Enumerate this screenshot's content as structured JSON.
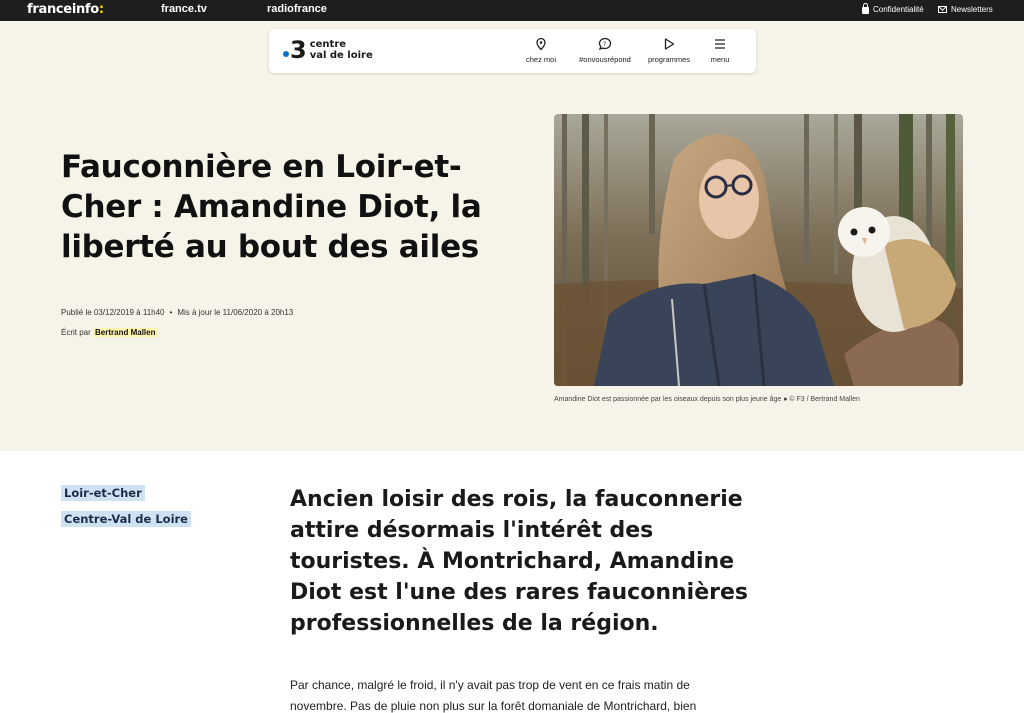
{
  "topbar": {
    "logo_main": "franceinfo",
    "logo_colon": ":",
    "link_francetv": "france.tv",
    "link_radiofrance": "radiofrance",
    "privacy": "Confidentialité",
    "newsletters": "Newsletters"
  },
  "nav": {
    "logo_number": "3",
    "region_line1": "centre",
    "region_line2": "val de loire",
    "items": [
      {
        "label": "chez moi",
        "icon": "location-pin-icon"
      },
      {
        "label": "#onvousrépond",
        "icon": "speech-bubble-icon"
      },
      {
        "label": "programmes",
        "icon": "play-icon"
      },
      {
        "label": "menu",
        "icon": "hamburger-menu-icon"
      }
    ]
  },
  "article": {
    "title": "Fauconnière en Loir-et-Cher : Amandine Diot, la liberté au bout des ailes",
    "published": "Publié le 03/12/2019 à 11h40",
    "separator": "•",
    "updated": "Mis à jour le 11/06/2020 à 20h13",
    "author_prefix": "Écrit par",
    "author_name": "Bertrand Mallen",
    "photo_caption": "Amandine Diot est passionnée par les oiseaux depuis son plus jeune âge ● © F3 / Bertrand Mallen",
    "tags": [
      "Loir-et-Cher",
      "Centre-Val de Loire"
    ],
    "lede": "Ancien loisir des rois, la fauconnerie attire désormais l'intérêt des touristes. À Montrichard, Amandine Diot est l'une des rares fauconnières professionnelles de la région.",
    "body": "Par chance, malgré le froid, il n'y avait pas trop de vent en ce frais matin de novembre. Pas de pluie non plus sur la forêt domaniale de Montrichard, bien"
  },
  "colors": {
    "topbar_bg": "#1e1e1e",
    "hero_bg": "#f6f4e9",
    "accent_yellow": "#ffd000",
    "tag_bg": "#cfe2f3",
    "logo_blue": "#0a6ed1"
  }
}
